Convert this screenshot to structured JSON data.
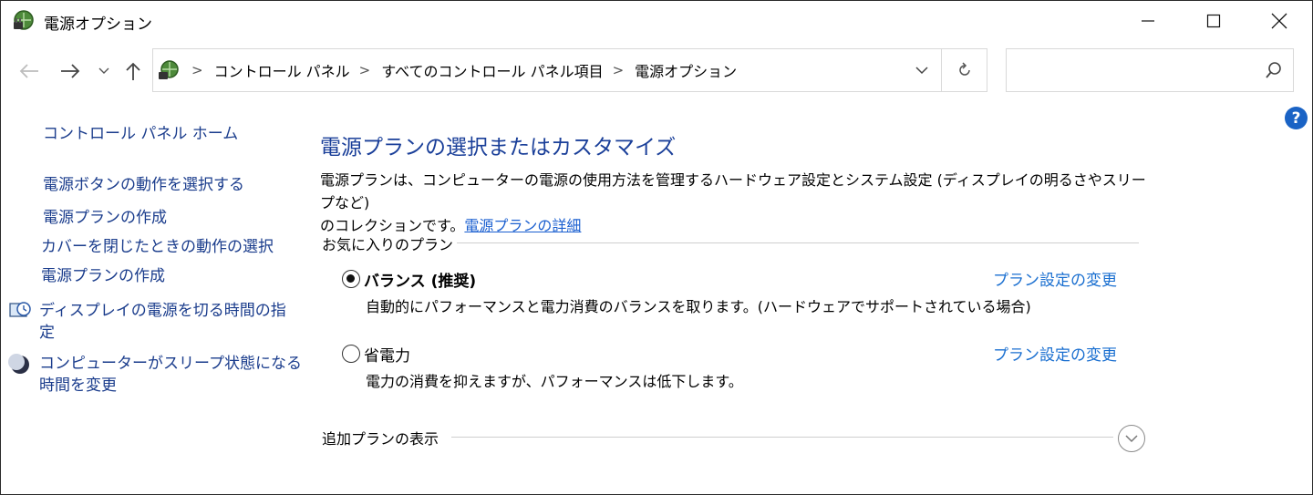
{
  "window": {
    "title": "電源オプション"
  },
  "nav": {
    "back_icon": "back-arrow-icon",
    "forward_icon": "forward-arrow-icon",
    "up_icon": "up-arrow-icon"
  },
  "address": {
    "breadcrumbs": [
      "コントロール パネル",
      "すべてのコントロール パネル項目",
      "電源オプション"
    ],
    "separator": ">"
  },
  "search": {
    "value": "",
    "placeholder": ""
  },
  "sidebar": {
    "home": "コントロール パネル ホーム",
    "items": [
      "電源ボタンの動作を選択する",
      "電源プランの作成",
      "カバーを閉じたときの動作の選択",
      "電源プランの作成",
      "ディスプレイの電源を切る時間の指",
      "コンピューターがスリープ状態になる"
    ],
    "item_wraps": {
      "display_line2": "定",
      "sleep_line2": "時間を変更"
    }
  },
  "main": {
    "title": "電源プランの選択またはカスタマイズ",
    "description_line1": "電源プランは、コンピューターの電源の使用方法を管理するハードウェア設定とシステム設定 (ディスプレイの明るさやスリープなど)",
    "description_line2_prefix": "のコレクションです。",
    "description_link": "電源プランの詳細",
    "favorites_label": "お気に入りのプラン",
    "plans": [
      {
        "name": "バランス (推奨)",
        "description": "自動的にパフォーマンスと電力消費のバランスを取ります。(ハードウェアでサポートされている場合)",
        "link": "プラン設定の変更",
        "selected": true
      },
      {
        "name": "省電力",
        "description": "電力の消費を抑えますが、パフォーマンスは低下します。",
        "link": "プラン設定の変更",
        "selected": false
      }
    ],
    "more_plans_label": "追加プランの表示"
  },
  "help": {
    "label": "?"
  },
  "colors": {
    "link": "#1a6fd0",
    "title": "#1a3f99",
    "sidebar_link": "#1a3c8c",
    "help_bg": "#1a63c5"
  }
}
